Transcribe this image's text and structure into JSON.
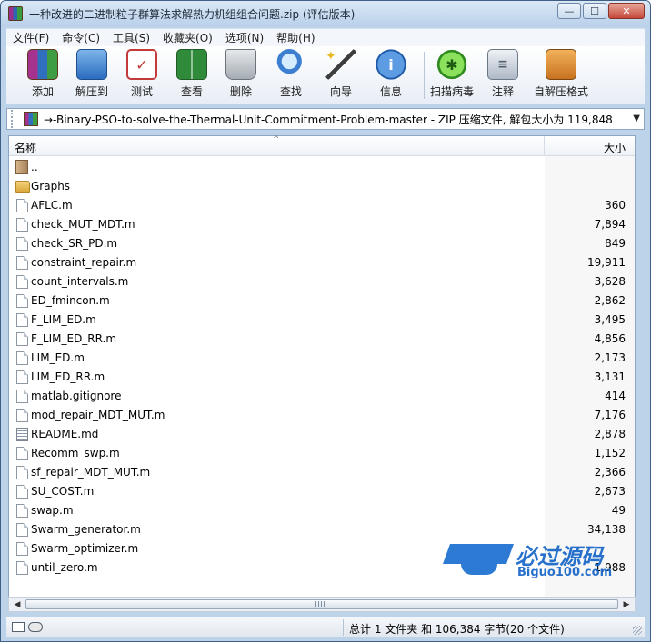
{
  "window": {
    "title": "一种改进的二进制粒子群算法求解热力机组组合问题.zip (评估版本)",
    "controls": {
      "minimize": "—",
      "maximize": "☐",
      "close": "✕"
    }
  },
  "menu": [
    "文件(F)",
    "命令(C)",
    "工具(S)",
    "收藏夹(O)",
    "选项(N)",
    "帮助(H)"
  ],
  "toolbar": [
    {
      "label": "添加",
      "icon": "rar-books-icon"
    },
    {
      "label": "解压到",
      "icon": "extract-folder-icon"
    },
    {
      "label": "测试",
      "icon": "test-clipboard-icon"
    },
    {
      "label": "查看",
      "icon": "view-book-icon"
    },
    {
      "label": "删除",
      "icon": "trash-bin-icon"
    },
    {
      "label": "查找",
      "icon": "magnifier-icon"
    },
    {
      "label": "向导",
      "icon": "wizard-wand-icon"
    },
    {
      "label": "信息",
      "icon": "info-icon"
    },
    {
      "label": "扫描病毒",
      "icon": "virus-scan-icon"
    },
    {
      "label": "注释",
      "icon": "comment-icon"
    },
    {
      "label": "自解压格式",
      "icon": "sfx-box-icon"
    }
  ],
  "address": {
    "text": "→-Binary-PSO-to-solve-the-Thermal-Unit-Commitment-Problem-master - ZIP 压缩文件, 解包大小为 119,848 字节"
  },
  "columns": {
    "name": "名称",
    "size": "大小"
  },
  "files": [
    {
      "name": "..",
      "size": "",
      "type": "up"
    },
    {
      "name": "Graphs",
      "size": "",
      "type": "folder"
    },
    {
      "name": "AFLC.m",
      "size": "360",
      "type": "file"
    },
    {
      "name": "check_MUT_MDT.m",
      "size": "7,894",
      "type": "file"
    },
    {
      "name": "check_SR_PD.m",
      "size": "849",
      "type": "file"
    },
    {
      "name": "constraint_repair.m",
      "size": "19,911",
      "type": "file"
    },
    {
      "name": "count_intervals.m",
      "size": "3,628",
      "type": "file"
    },
    {
      "name": "ED_fmincon.m",
      "size": "2,862",
      "type": "file"
    },
    {
      "name": "F_LIM_ED.m",
      "size": "3,495",
      "type": "file"
    },
    {
      "name": "F_LIM_ED_RR.m",
      "size": "4,856",
      "type": "file"
    },
    {
      "name": "LIM_ED.m",
      "size": "2,173",
      "type": "file"
    },
    {
      "name": "LIM_ED_RR.m",
      "size": "3,131",
      "type": "file"
    },
    {
      "name": "matlab.gitignore",
      "size": "414",
      "type": "file"
    },
    {
      "name": "mod_repair_MDT_MUT.m",
      "size": "7,176",
      "type": "file"
    },
    {
      "name": "README.md",
      "size": "2,878",
      "type": "md"
    },
    {
      "name": "Recomm_swp.m",
      "size": "1,152",
      "type": "file"
    },
    {
      "name": "sf_repair_MDT_MUT.m",
      "size": "2,366",
      "type": "file"
    },
    {
      "name": "SU_COST.m",
      "size": "2,673",
      "type": "file"
    },
    {
      "name": "swap.m",
      "size": "49",
      "type": "file"
    },
    {
      "name": "Swarm_generator.m",
      "size": "34,138",
      "type": "file"
    },
    {
      "name": "Swarm_optimizer.m",
      "size": "",
      "type": "file"
    },
    {
      "name": "until_zero.m",
      "size": "1,988",
      "type": "file"
    }
  ],
  "status": {
    "text": "总计 1 文件夹 和 106,384 字节(20 个文件)"
  },
  "watermark": {
    "title": "必过源码",
    "subtitle": "Biguo100.com"
  }
}
